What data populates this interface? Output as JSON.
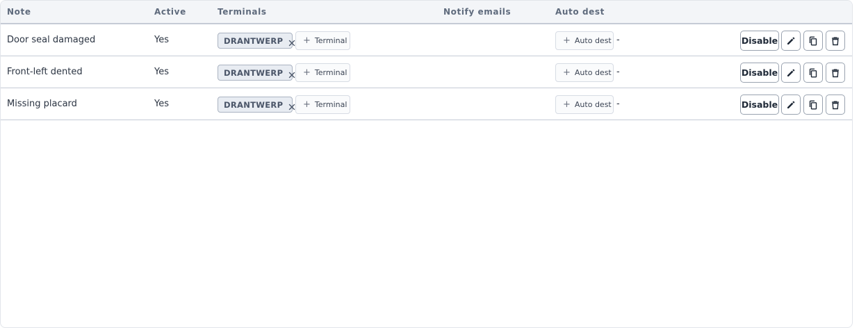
{
  "table": {
    "headers": {
      "note": "Note",
      "active": "Active",
      "terminals": "Terminals",
      "notify_emails": "Notify emails",
      "auto_dest": "Auto dest"
    },
    "rows": [
      {
        "note": "Door seal damaged",
        "active": "Yes",
        "terminal_chip": "DRANTWERP",
        "add_terminal_label": "Terminal",
        "notify_emails": "",
        "add_auto_dest_label": "Auto dest",
        "auto_dest_value": "-",
        "disable_label": "Disable"
      },
      {
        "note": "Front-left dented",
        "active": "Yes",
        "terminal_chip": "DRANTWERP",
        "add_terminal_label": "Terminal",
        "notify_emails": "",
        "add_auto_dest_label": "Auto dest",
        "auto_dest_value": "-",
        "disable_label": "Disable"
      },
      {
        "note": "Missing placard",
        "active": "Yes",
        "terminal_chip": "DRANTWERP",
        "add_terminal_label": "Terminal",
        "notify_emails": "",
        "add_auto_dest_label": "Auto dest",
        "auto_dest_value": "-",
        "disable_label": "Disable"
      }
    ]
  },
  "icons": {
    "remove_chip": "close-icon",
    "add": "plus-icon",
    "edit": "pencil-icon",
    "duplicate": "copy-icon",
    "delete": "trash-icon"
  },
  "colors": {
    "header_bg": "#f3f5f8",
    "header_text": "#5f6b7d",
    "chip_bg": "#e8ecf2",
    "border": "#c5cbd6"
  }
}
